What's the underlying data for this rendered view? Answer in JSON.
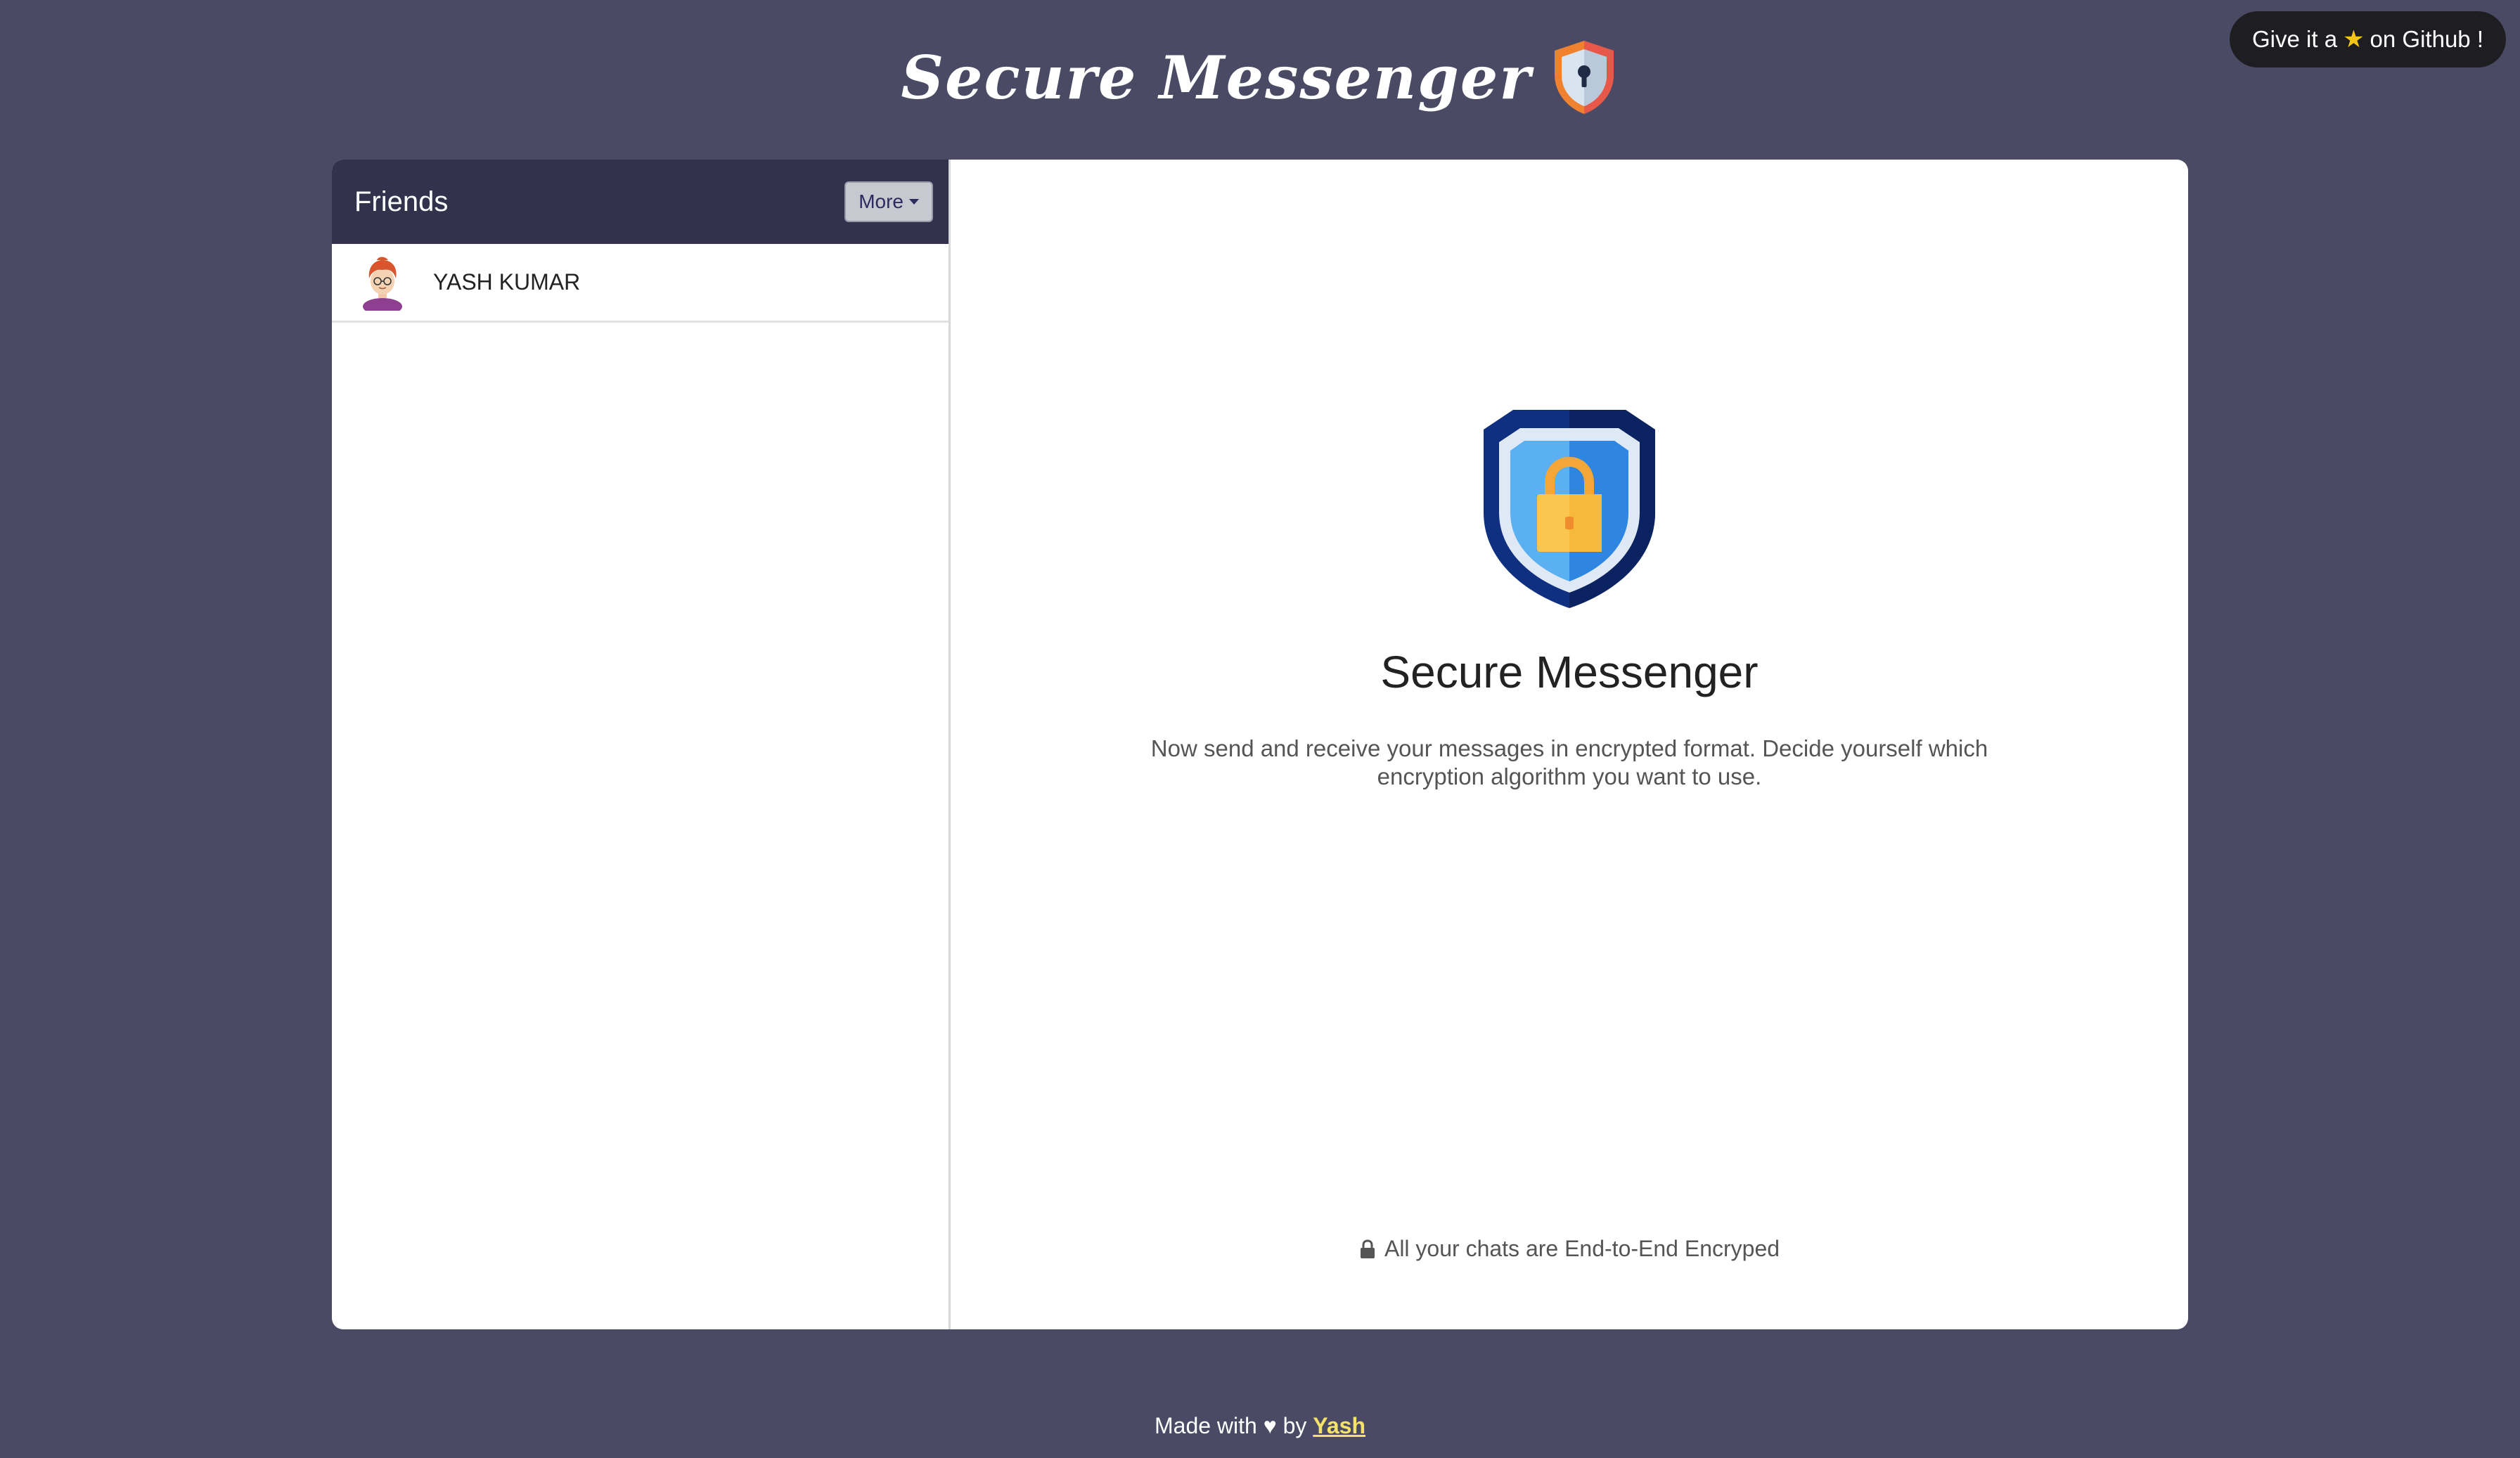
{
  "header": {
    "title": "Secure Messenger",
    "github_label_pre": "Give it a",
    "github_label_post": "on Github !"
  },
  "sidebar": {
    "title": "Friends",
    "more_label": "More",
    "friends": [
      {
        "name": "YASH KUMAR"
      }
    ]
  },
  "main": {
    "title": "Secure Messenger",
    "description": "Now send and receive your messages in encrypted format. Decide yourself which encryption algorithm you want to use.",
    "e2e_note": "All your chats are End-to-End Encryped"
  },
  "footer": {
    "made_with": "Made with",
    "by": "by",
    "author": "Yash"
  },
  "colors": {
    "background": "#4a4a64",
    "sidebar_header": "#32324d",
    "link_accent": "#f4e26a",
    "shield_dark": "#0d2a73",
    "shield_blue": "#3a8ee6",
    "lock_yellow": "#f9c74f"
  }
}
